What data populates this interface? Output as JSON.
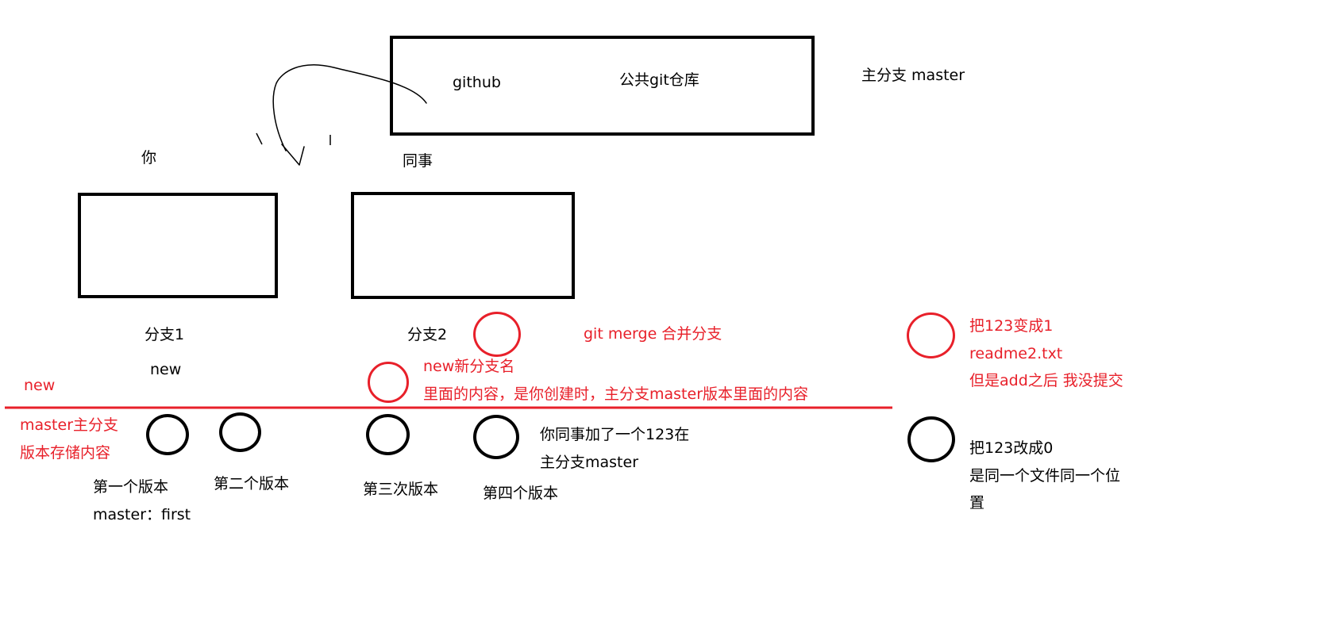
{
  "colors": {
    "ink": "#000000",
    "annotation": "#e8202a",
    "background": "#ffffff"
  },
  "repo": {
    "name": "github",
    "description": "公共git仓库",
    "branch_label": "主分支 master"
  },
  "people": {
    "you": "你",
    "colleague": "同事"
  },
  "branches": {
    "branch1": "分支1",
    "branch1_sub": "new",
    "branch2": "分支2"
  },
  "annotations": {
    "merge": "git merge 合并分支",
    "new_branch_title": "new新分支名",
    "new_branch_desc": "里面的内容，是你创建时，主分支master版本里面的内容",
    "new_line_label": "new",
    "master_line_label_1": "master主分支",
    "master_line_label_2": "版本存储内容",
    "right_red_1": "把123变成1",
    "right_red_2": "readme2.txt",
    "right_red_3": "但是add之后 我没提交"
  },
  "versions": {
    "v1": "第一个版本",
    "v1_sub": "master：first",
    "v2": "第二个版本",
    "v3": "第三次版本",
    "v4": "第四个版本",
    "v4_note_1": "你同事加了一个123在",
    "v4_note_2": "主分支master"
  },
  "right_black": {
    "line1": "把123改成0",
    "line2": "是同一个文件同一个位",
    "line3": "置"
  }
}
